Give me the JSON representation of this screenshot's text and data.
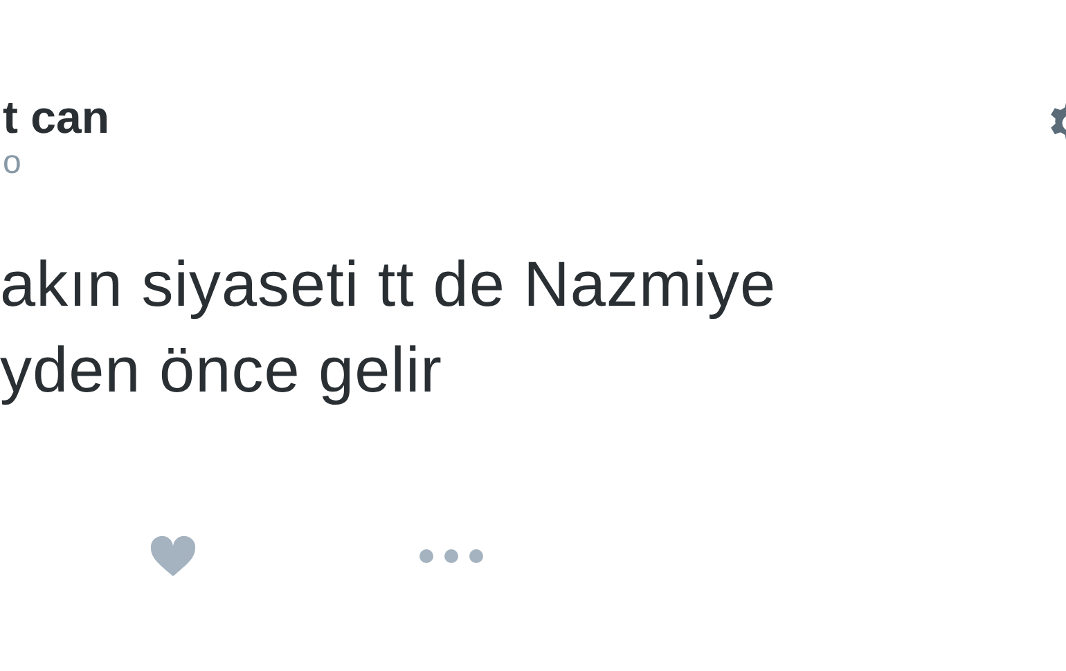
{
  "author": {
    "name": "t can",
    "handle": "o"
  },
  "tweet": {
    "lines": [
      "akın siyaseti tt de Nazmiye",
      "yden önce gelir"
    ]
  },
  "actions": [
    {
      "kind": "like"
    },
    {
      "kind": "more"
    }
  ]
}
